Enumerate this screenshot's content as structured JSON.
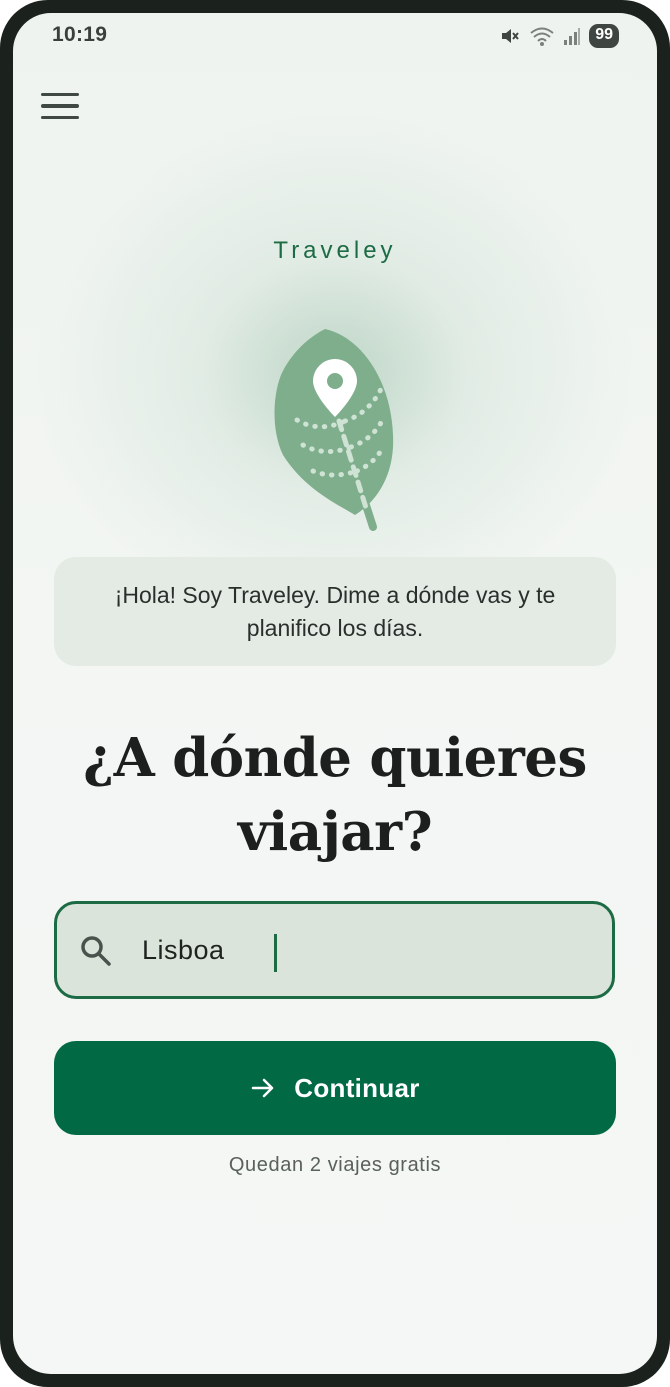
{
  "status_bar": {
    "time": "10:19",
    "battery": "99",
    "icons": [
      "mute-icon",
      "wifi-icon",
      "signal-icon"
    ]
  },
  "header": {
    "menu_icon": "hamburger-menu-icon"
  },
  "brand": {
    "name": "Traveley",
    "logo_icon": "leaf-location-pin-icon"
  },
  "greeting": {
    "text": "¡Hola! Soy Traveley. Dime a dónde vas y te planifico los días."
  },
  "heading": {
    "text": "¿A dónde quieres viajar?"
  },
  "search": {
    "value": "Lisboa",
    "icon": "search-icon"
  },
  "continue_button": {
    "label": "Continuar",
    "icon": "arrow-right-icon"
  },
  "footer": {
    "trips_left": "Quedan 2 viajes gratis"
  },
  "colors": {
    "primary": "#016a45",
    "brand_text": "#1d6b45",
    "leaf": "#7fae8c",
    "input_bg": "#dbe4da",
    "bubble_bg": "#e4ebe5"
  }
}
